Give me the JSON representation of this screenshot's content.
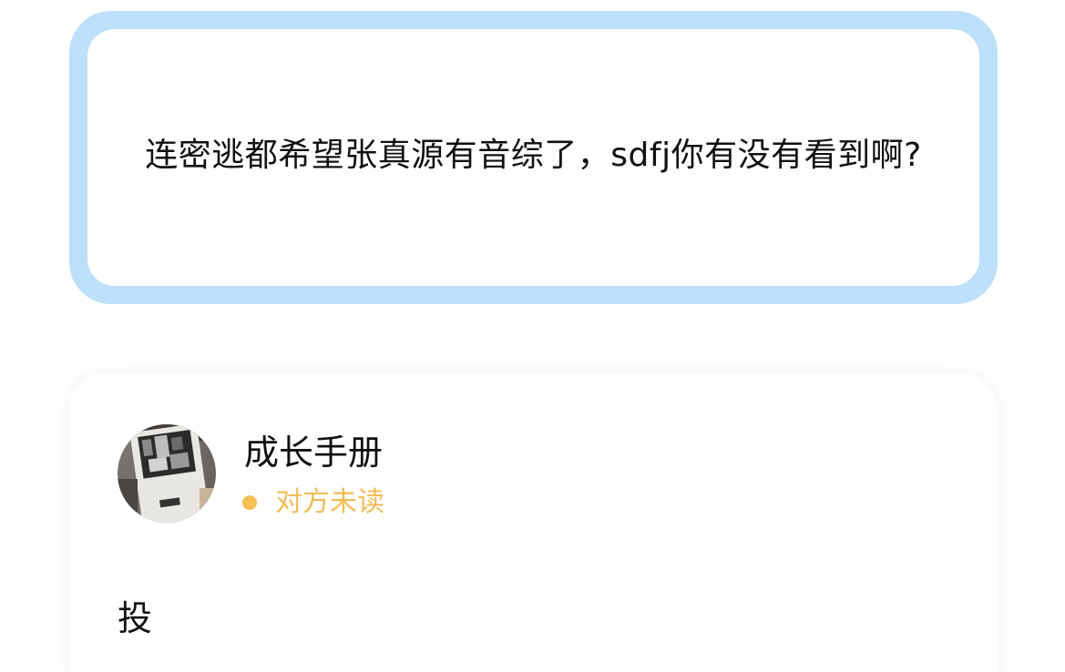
{
  "quote": {
    "text": "连密逃都希望张真源有音综了，sdfj你有没有看到啊?"
  },
  "reply": {
    "avatar_icon": "book-cover-avatar",
    "username": "成长手册",
    "status": "对方未读",
    "status_color": "#f6c052",
    "message": "投"
  },
  "colors": {
    "quote_border": "#bde0fb",
    "background": "#ffffff"
  }
}
